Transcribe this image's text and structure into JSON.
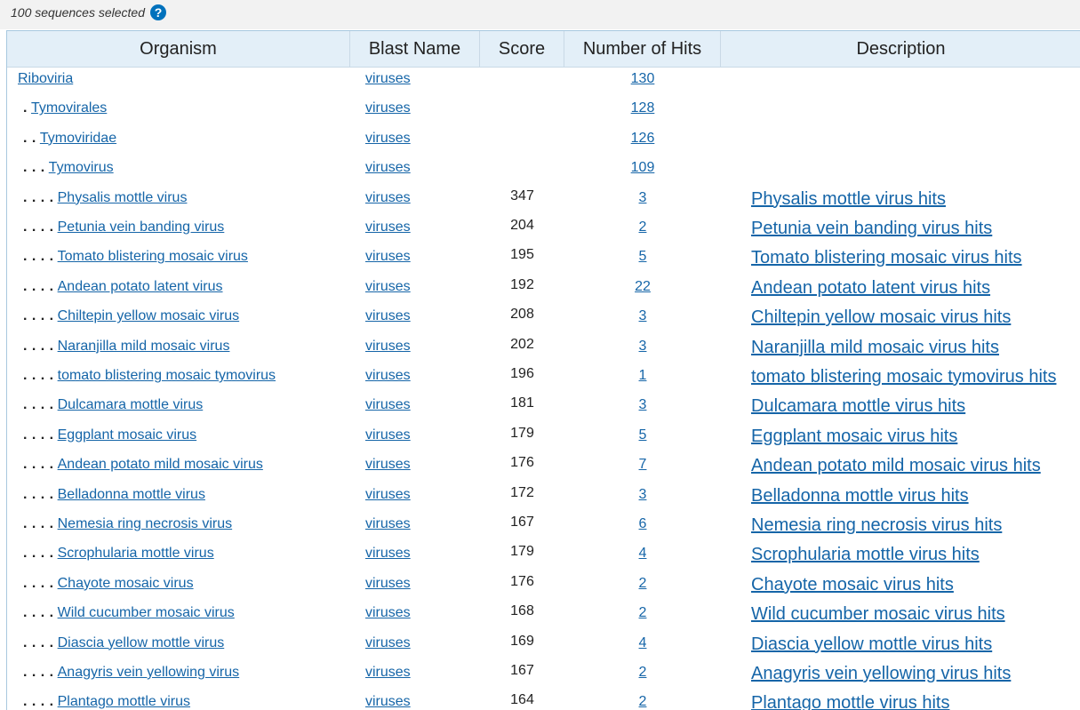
{
  "topbar": {
    "selected_text": "100 sequences selected",
    "help_icon": "help-icon",
    "help_glyph": "?"
  },
  "table": {
    "headers": {
      "organism": "Organism",
      "blast_name": "Blast Name",
      "score": "Score",
      "hits": "Number of Hits",
      "description": "Description"
    },
    "rows": [
      {
        "dots": "",
        "organism": "Riboviria",
        "blast_name": "viruses",
        "score": "",
        "hits": "130",
        "description": ""
      },
      {
        "dots": ".",
        "organism": "Tymovirales",
        "blast_name": "viruses",
        "score": "",
        "hits": "128",
        "description": ""
      },
      {
        "dots": ". .",
        "organism": "Tymoviridae",
        "blast_name": "viruses",
        "score": "",
        "hits": "126",
        "description": ""
      },
      {
        "dots": ". . .",
        "organism": "Tymovirus",
        "blast_name": "viruses",
        "score": "",
        "hits": "109",
        "description": ""
      },
      {
        "dots": ". . . .",
        "organism": "Physalis mottle virus",
        "blast_name": "viruses",
        "score": "347",
        "hits": "3",
        "description": "Physalis mottle virus hits"
      },
      {
        "dots": ". . . .",
        "organism": "Petunia vein banding virus",
        "blast_name": "viruses",
        "score": "204",
        "hits": "2",
        "description": "Petunia vein banding virus hits"
      },
      {
        "dots": ". . . .",
        "organism": "Tomato blistering mosaic virus",
        "blast_name": "viruses",
        "score": "195",
        "hits": "5",
        "description": "Tomato blistering mosaic virus hits"
      },
      {
        "dots": ". . . .",
        "organism": "Andean potato latent virus",
        "blast_name": "viruses",
        "score": "192",
        "hits": "22",
        "description": "Andean potato latent virus hits"
      },
      {
        "dots": ". . . .",
        "organism": "Chiltepin yellow mosaic virus",
        "blast_name": "viruses",
        "score": "208",
        "hits": "3",
        "description": "Chiltepin yellow mosaic virus hits"
      },
      {
        "dots": ". . . .",
        "organism": "Naranjilla mild mosaic virus",
        "blast_name": "viruses",
        "score": "202",
        "hits": "3",
        "description": "Naranjilla mild mosaic virus hits"
      },
      {
        "dots": ". . . .",
        "organism": "tomato blistering mosaic tymovirus",
        "blast_name": "viruses",
        "score": "196",
        "hits": "1",
        "description": "tomato blistering mosaic tymovirus hits"
      },
      {
        "dots": ". . . .",
        "organism": "Dulcamara mottle virus",
        "blast_name": "viruses",
        "score": "181",
        "hits": "3",
        "description": "Dulcamara mottle virus hits"
      },
      {
        "dots": ". . . .",
        "organism": "Eggplant mosaic virus",
        "blast_name": "viruses",
        "score": "179",
        "hits": "5",
        "description": "Eggplant mosaic virus hits"
      },
      {
        "dots": ". . . .",
        "organism": "Andean potato mild mosaic virus",
        "blast_name": "viruses",
        "score": "176",
        "hits": "7",
        "description": "Andean potato mild mosaic virus hits"
      },
      {
        "dots": ". . . .",
        "organism": "Belladonna mottle virus",
        "blast_name": "viruses",
        "score": "172",
        "hits": "3",
        "description": "Belladonna mottle virus hits"
      },
      {
        "dots": ". . . .",
        "organism": "Nemesia ring necrosis virus",
        "blast_name": "viruses",
        "score": "167",
        "hits": "6",
        "description": "Nemesia ring necrosis virus hits"
      },
      {
        "dots": ". . . .",
        "organism": "Scrophularia mottle virus",
        "blast_name": "viruses",
        "score": "179",
        "hits": "4",
        "description": "Scrophularia mottle virus hits"
      },
      {
        "dots": ". . . .",
        "organism": "Chayote mosaic virus",
        "blast_name": "viruses",
        "score": "176",
        "hits": "2",
        "description": "Chayote mosaic virus hits"
      },
      {
        "dots": ". . . .",
        "organism": "Wild cucumber mosaic virus",
        "blast_name": "viruses",
        "score": "168",
        "hits": "2",
        "description": "Wild cucumber mosaic virus hits"
      },
      {
        "dots": ". . . .",
        "organism": "Diascia yellow mottle virus",
        "blast_name": "viruses",
        "score": "169",
        "hits": "4",
        "description": "Diascia yellow mottle virus hits"
      },
      {
        "dots": ". . . .",
        "organism": "Anagyris vein yellowing virus",
        "blast_name": "viruses",
        "score": "167",
        "hits": "2",
        "description": "Anagyris vein yellowing virus hits"
      },
      {
        "dots": ". . . .",
        "organism": "Plantago mottle virus",
        "blast_name": "viruses",
        "score": "164",
        "hits": "2",
        "description": "Plantago mottle virus hits"
      }
    ]
  },
  "colors": {
    "link": "#1565a8",
    "header_bg": "#e3eff8",
    "border": "#a8c8df",
    "help_icon": "#0071bc"
  }
}
